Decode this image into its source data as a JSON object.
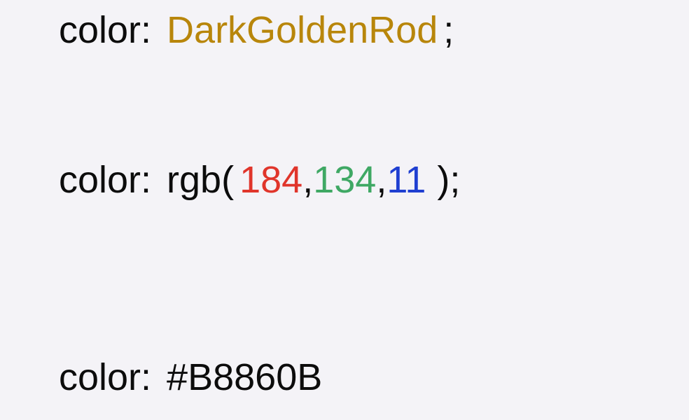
{
  "rows": [
    {
      "property": "color:",
      "value": "DarkGoldenRod",
      "terminator": ";"
    },
    {
      "property": "color:",
      "func_open": "rgb(",
      "r": "184",
      "sep1": ",",
      "g": "134",
      "sep2": ",",
      "b": "11",
      "func_close": ");"
    },
    {
      "property": "color:",
      "value": "#B8860B"
    }
  ],
  "colors": {
    "text": "#0c0c0c",
    "goldenrod": "#b8860b",
    "red": "#e0352b",
    "green": "#3fa864",
    "blue": "#1f3fd1",
    "background": "#f4f3f7"
  }
}
